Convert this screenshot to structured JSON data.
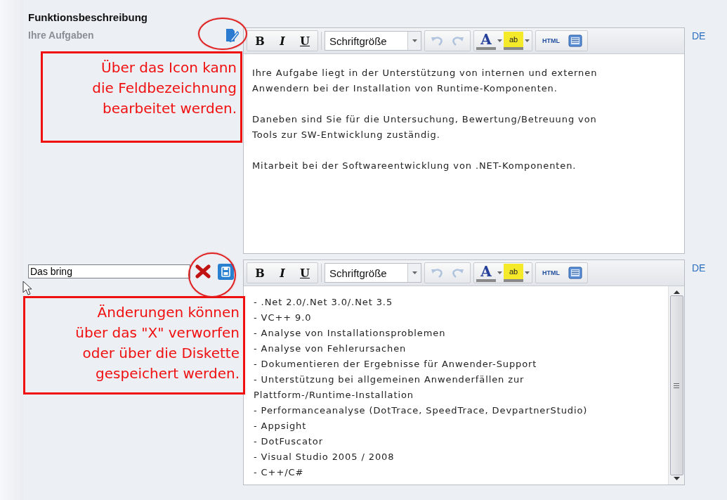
{
  "heading": "Funktionsbeschreibung",
  "fields": [
    {
      "kind": "label",
      "label": "Ihre Aufgaben",
      "language": "DE",
      "scrollable": false,
      "toolbar": {
        "format_buttons": [
          "B",
          "I",
          "U"
        ],
        "font_size": "Schriftgröße",
        "undo_disabled": true,
        "redo_disabled": true,
        "font_color": "A",
        "highlight": "ab",
        "html": "HTML"
      },
      "paragraphs": [
        "Ihre Aufgabe liegt in der Unterstützung von internen und externen\nAnwendern bei der Installation von Runtime-Komponenten.",
        "Daneben sind Sie für die Untersuchung, Bewertung/Betreuung von\nTools zur SW-Entwicklung zuständig.",
        "Mitarbeit bei der Softwareentwicklung von .NET-Komponenten."
      ]
    },
    {
      "kind": "editing",
      "value": "Das bring",
      "language": "DE",
      "scrollable": true,
      "toolbar": {
        "format_buttons": [
          "B",
          "I",
          "U"
        ],
        "font_size": "Schriftgröße",
        "undo_disabled": true,
        "redo_disabled": true,
        "font_color": "A",
        "highlight": "ab",
        "html": "HTML"
      },
      "paragraphs": [
        "- .Net 2.0/.Net 3.0/.Net 3.5",
        "- VC++ 9.0",
        "- Analyse von Installationsproblemen",
        "- Analyse von Fehlerursachen",
        "- Dokumentieren der Ergebnisse für Anwender-Support",
        "- Unterstützung bei allgemeinen Anwenderfällen zur\nPlattform-/Runtime-Installation",
        "- Performanceanalyse (DotTrace, SpeedTrace, DevpartnerStudio)",
        "- Appsight",
        "- DotFuscator",
        "- Visual Studio 2005 / 2008",
        "- C++/C#"
      ]
    }
  ],
  "annotations": [
    "Über das Icon kann\ndie Feldbezeichnung\nbearbeitet werden.",
    "Änderungen können\nüber das \"X\" verworfen\noder über die Diskette\ngespeichert werden."
  ]
}
